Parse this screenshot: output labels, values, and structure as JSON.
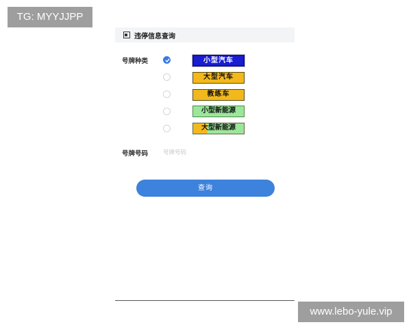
{
  "watermarks": {
    "top_left": "TG: MYYJJPP",
    "bottom_right": "www.lebo-yule.vip"
  },
  "header": {
    "icon": "document-icon",
    "title": "违停信息查询"
  },
  "form": {
    "plate_type_label": "号牌种类",
    "plate_types": [
      {
        "label": "小型汽车",
        "color": "blue",
        "selected": true
      },
      {
        "label": "大型汽车",
        "color": "yellow",
        "selected": false
      },
      {
        "label": "教练车",
        "color": "yellow",
        "selected": false
      },
      {
        "label": "小型新能源",
        "color": "green",
        "selected": false
      },
      {
        "label": "大型新能源",
        "color": "yellow-green",
        "selected": false
      }
    ],
    "plate_number_label": "号牌号码",
    "plate_number_placeholder": "号牌号码",
    "plate_number_value": ""
  },
  "actions": {
    "query_label": "查询"
  },
  "colors": {
    "accent": "#3d82dc",
    "plate_blue": "#1a1ed0",
    "plate_yellow": "#f2b81c",
    "plate_green": "#9ce69a"
  }
}
